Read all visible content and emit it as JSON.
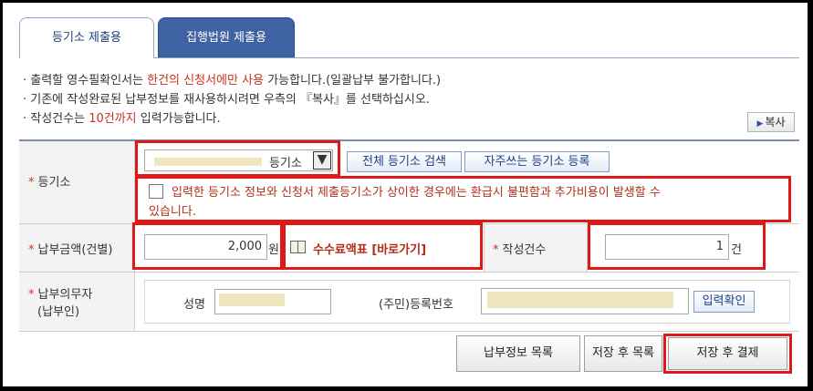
{
  "tabs": [
    {
      "label": "등기소 제출용"
    },
    {
      "label": "집행법원 제출용"
    }
  ],
  "notices": {
    "line1": {
      "a": "· 출력할 영수필확인서는 ",
      "b": "한건의 신청서에만 사용",
      "c": " 가능합니다.(일괄납부 불가합니다.)"
    },
    "line2": {
      "a": "· 기존에 작성완료된 납부정보를 재사용하시려면 우측의 『복사』를 선택하십시오."
    },
    "line3": {
      "a": "· 작성건수는 ",
      "b": "10건까지",
      "c": " 입력가능합니다."
    }
  },
  "copy_button": {
    "label": "복사"
  },
  "form": {
    "registry": {
      "label": "등기소",
      "select_value": "등기소",
      "search_button": "전체 등기소 검색",
      "favorite_button": "자주쓰는 등기소 등록",
      "warning_line1": "입력한 등기소 정보와 신청서 제출등기소가 상이한 경우에는 환급시 불편함과 추가비용이 발생할 수",
      "warning_line2": "있습니다."
    },
    "amount": {
      "label": "납부금액(건별)",
      "value": "2,000",
      "unit": "원",
      "fee_link": "수수료액표 [바로가기]"
    },
    "count": {
      "label": "작성건수",
      "value": "1",
      "unit": "건"
    },
    "payer": {
      "label_line1": "납부의무자",
      "label_line2": "(납부인)",
      "name_label": "성명",
      "id_label": "(주민)등록번호",
      "confirm_button": "입력확인"
    }
  },
  "actions": {
    "list": "납부정보 목록",
    "save_list": "저장 후 목록",
    "save_pay": "저장 후 결제"
  },
  "colors": {
    "highlight_red": "#e01818",
    "accent_blue": "#3f62a3",
    "notice_red": "#c8321f"
  }
}
